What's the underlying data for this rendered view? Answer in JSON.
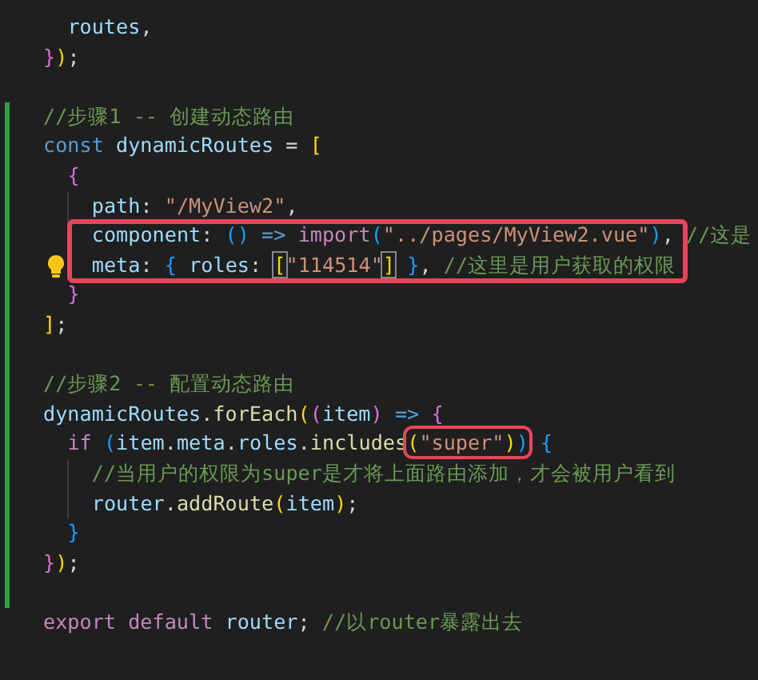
{
  "editor": {
    "lines": [
      {
        "kind": "continued",
        "children": [
          {
            "kind": "code",
            "tokens": [
              {
                "text": "routes",
                "kind": "var"
              },
              {
                "text": ",",
                "kind": "punct"
              }
            ]
          }
        ]
      },
      {
        "kind": "code",
        "tokens": [
          {
            "text": "}",
            "kind": "b2"
          },
          {
            "text": ")",
            "kind": "b1"
          },
          {
            "text": ";",
            "kind": "punct"
          }
        ]
      },
      {
        "kind": "blank"
      },
      {
        "kind": "code",
        "modified": true,
        "tokens": [
          {
            "text": "//步骤1 -- 创建动态路由",
            "kind": "cmt"
          }
        ]
      },
      {
        "kind": "code",
        "modified": true,
        "tokens": [
          {
            "text": "const ",
            "kind": "decl"
          },
          {
            "text": "dynamicRoutes",
            "kind": "var"
          },
          {
            "text": " = ",
            "kind": "punct"
          },
          {
            "text": "[",
            "kind": "b1"
          }
        ],
        "children": [
          {
            "kind": "code",
            "modified": true,
            "tokens": [
              {
                "text": "{",
                "kind": "b2"
              }
            ],
            "children": [
              {
                "kind": "code",
                "modified": true,
                "tokens": [
                  {
                    "text": "path",
                    "kind": "var"
                  },
                  {
                    "text": ": ",
                    "kind": "punct"
                  },
                  {
                    "text": "\"/MyView2\"",
                    "kind": "str"
                  },
                  {
                    "text": ",",
                    "kind": "punct"
                  }
                ]
              },
              {
                "kind": "code",
                "modified": true,
                "tokens": [
                  {
                    "text": "component",
                    "kind": "var"
                  },
                  {
                    "text": ": ",
                    "kind": "punct"
                  },
                  {
                    "text": "()",
                    "kind": "b3"
                  },
                  {
                    "text": " => ",
                    "kind": "decl"
                  },
                  {
                    "text": "import",
                    "kind": "kw"
                  },
                  {
                    "text": "(",
                    "kind": "b3"
                  },
                  {
                    "text": "\"../pages/MyView2.vue\"",
                    "kind": "str"
                  },
                  {
                    "text": ")",
                    "kind": "b3"
                  },
                  {
                    "text": ", ",
                    "kind": "punct"
                  },
                  {
                    "text": "//这是",
                    "kind": "cmt"
                  }
                ]
              },
              {
                "kind": "code",
                "modified": true,
                "lightbulb": true,
                "tokens": [
                  {
                    "text": "meta",
                    "kind": "var"
                  },
                  {
                    "text": ": ",
                    "kind": "punct"
                  },
                  {
                    "text": "{",
                    "kind": "b3"
                  },
                  {
                    "text": " roles",
                    "kind": "var"
                  },
                  {
                    "text": ": ",
                    "kind": "punct"
                  },
                  {
                    "text": "[",
                    "kind": "match"
                  },
                  {
                    "text": "\"114514\"",
                    "kind": "str"
                  },
                  {
                    "text": "]",
                    "kind": "match"
                  },
                  {
                    "text": " }",
                    "kind": "b3"
                  },
                  {
                    "text": ", ",
                    "kind": "punct"
                  },
                  {
                    "text": "//这里是用户获取的权限",
                    "kind": "cmt"
                  }
                ]
              }
            ]
          },
          {
            "kind": "code",
            "modified": true,
            "tokens": [
              {
                "text": "}",
                "kind": "b2"
              }
            ]
          }
        ]
      },
      {
        "kind": "code",
        "modified": true,
        "tokens": [
          {
            "text": "]",
            "kind": "b1"
          },
          {
            "text": ";",
            "kind": "punct"
          }
        ]
      },
      {
        "kind": "blank",
        "modified": true
      },
      {
        "kind": "code",
        "modified": true,
        "tokens": [
          {
            "text": "//步骤2 -- 配置动态路由",
            "kind": "cmt"
          }
        ]
      },
      {
        "kind": "code",
        "modified": true,
        "tokens": [
          {
            "text": "dynamicRoutes",
            "kind": "var"
          },
          {
            "text": ".",
            "kind": "punct"
          },
          {
            "text": "forEach",
            "kind": "fn"
          },
          {
            "text": "(",
            "kind": "b1"
          },
          {
            "text": "(",
            "kind": "b2"
          },
          {
            "text": "item",
            "kind": "var"
          },
          {
            "text": ")",
            "kind": "b2"
          },
          {
            "text": " => ",
            "kind": "decl"
          },
          {
            "text": "{",
            "kind": "b2"
          }
        ],
        "children": [
          {
            "kind": "code",
            "modified": true,
            "tokens": [
              {
                "text": "if ",
                "kind": "kw"
              },
              {
                "text": "(",
                "kind": "b3"
              },
              {
                "text": "item",
                "kind": "var"
              },
              {
                "text": ".",
                "kind": "punct"
              },
              {
                "text": "meta",
                "kind": "var"
              },
              {
                "text": ".",
                "kind": "punct"
              },
              {
                "text": "roles",
                "kind": "var"
              },
              {
                "text": ".",
                "kind": "punct"
              },
              {
                "text": "includes",
                "kind": "fn"
              },
              {
                "text": "(",
                "kind": "b1",
                "highlighted": true
              },
              {
                "text": "\"super\"",
                "kind": "str",
                "highlighted": true
              },
              {
                "text": ")",
                "kind": "b1",
                "highlighted": true
              },
              {
                "text": ")",
                "kind": "b3",
                "highlighted": true
              },
              {
                "text": " {",
                "kind": "b3"
              }
            ],
            "children": [
              {
                "kind": "code",
                "modified": true,
                "tokens": [
                  {
                    "text": "//当用户的权限为super是才将上面路由添加，才会被用户看到",
                    "kind": "cmt"
                  }
                ]
              },
              {
                "kind": "code",
                "modified": true,
                "tokens": [
                  {
                    "text": "router",
                    "kind": "var"
                  },
                  {
                    "text": ".",
                    "kind": "punct"
                  },
                  {
                    "text": "addRoute",
                    "kind": "fn"
                  },
                  {
                    "text": "(",
                    "kind": "b1"
                  },
                  {
                    "text": "item",
                    "kind": "var"
                  },
                  {
                    "text": ")",
                    "kind": "b1"
                  },
                  {
                    "text": ";",
                    "kind": "punct"
                  }
                ]
              }
            ]
          },
          {
            "kind": "code",
            "modified": true,
            "tokens": [
              {
                "text": "}",
                "kind": "b3"
              }
            ]
          }
        ]
      },
      {
        "kind": "code",
        "modified": true,
        "tokens": [
          {
            "text": "}",
            "kind": "b2"
          },
          {
            "text": ")",
            "kind": "b1"
          },
          {
            "text": ";",
            "kind": "punct"
          }
        ]
      },
      {
        "kind": "blank",
        "modified": true
      },
      {
        "kind": "code",
        "tokens": [
          {
            "text": "export default ",
            "kind": "kw"
          },
          {
            "text": "router",
            "kind": "var"
          },
          {
            "text": "; ",
            "kind": "punct"
          },
          {
            "text": "//以router暴露出去",
            "kind": "cmt"
          }
        ]
      }
    ]
  }
}
